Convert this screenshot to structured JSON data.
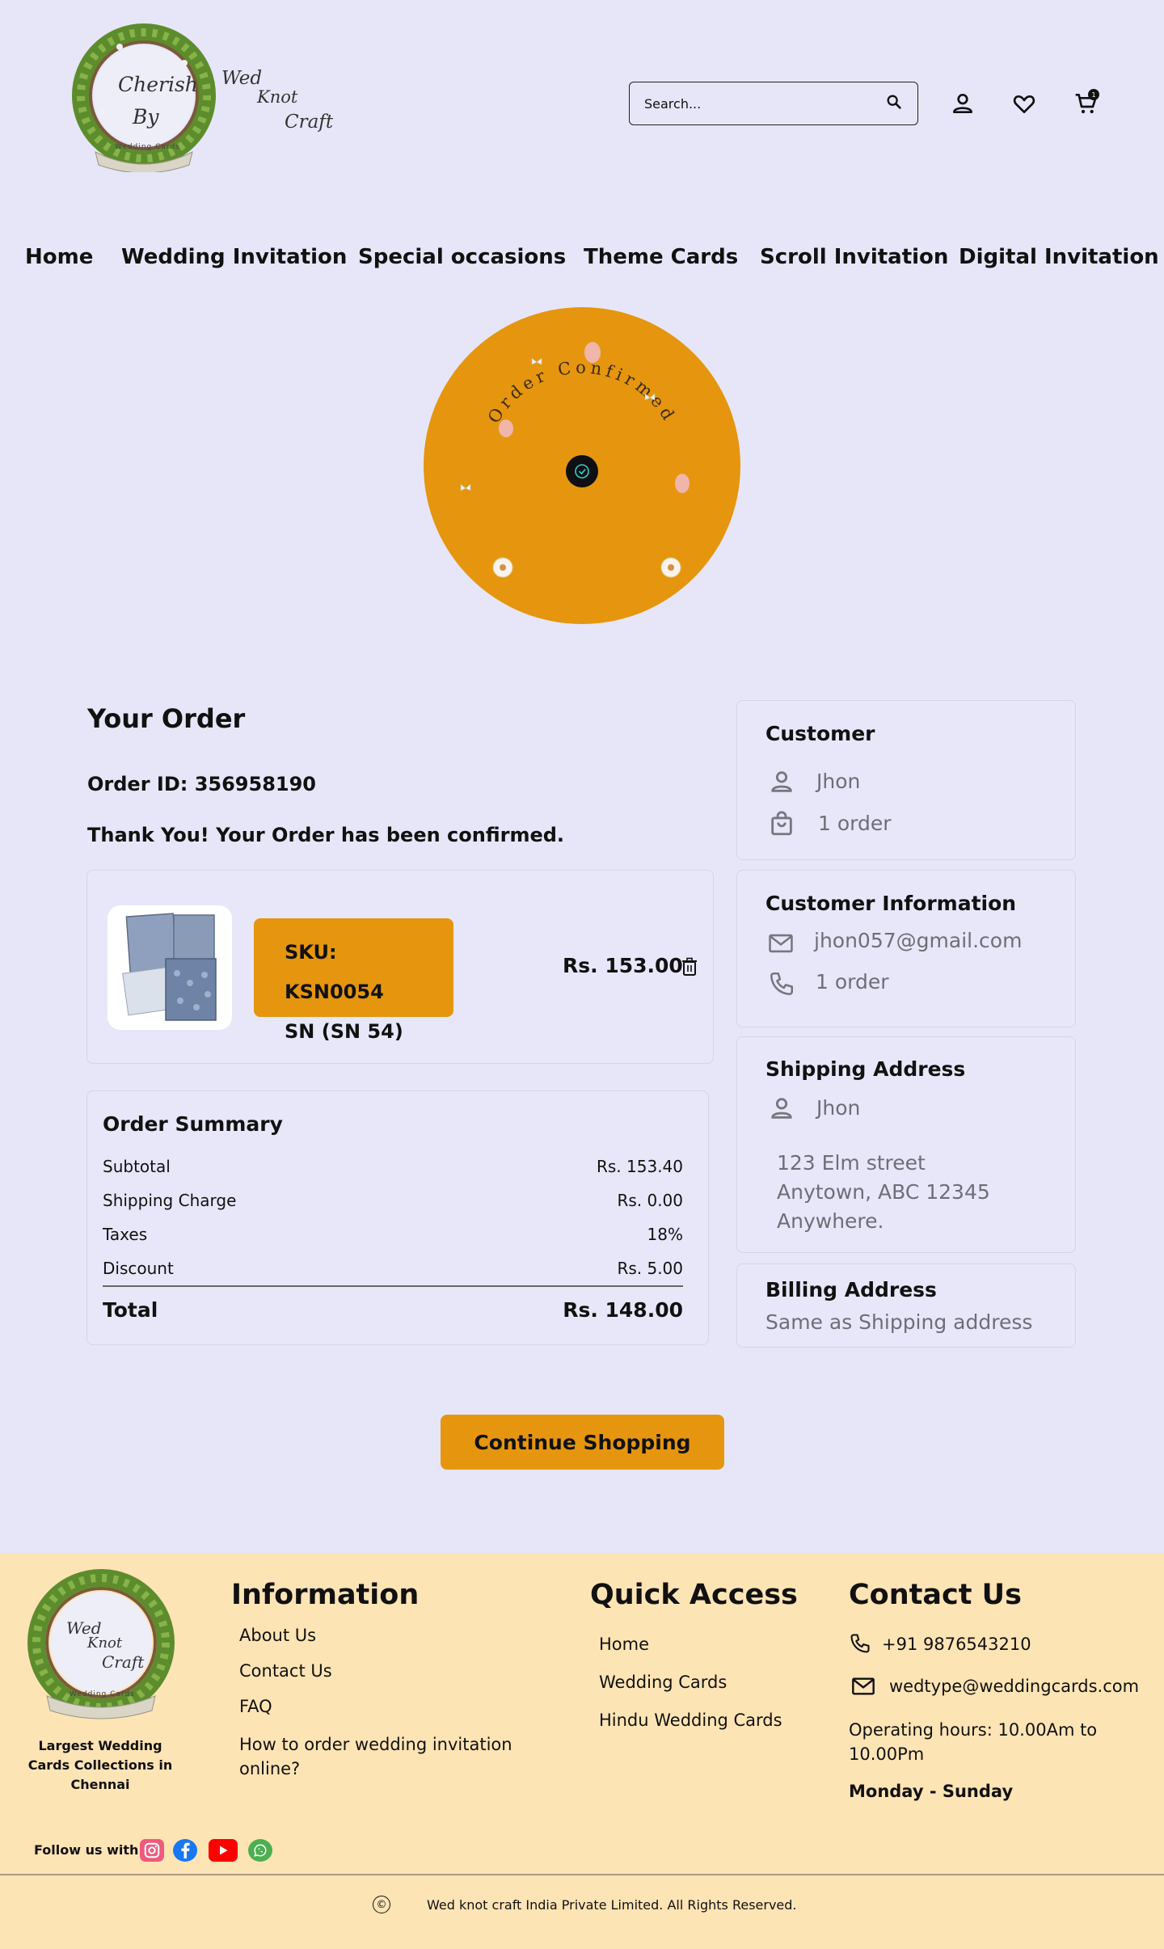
{
  "header": {
    "logo": {
      "line1": "Cherish",
      "line2": "By",
      "line3": "Wed",
      "line4": "Knot",
      "line5": "Craft",
      "ribbon": "Wedding Cards"
    },
    "search_placeholder": "Search...",
    "cart_count": "1"
  },
  "nav": {
    "items": [
      "Home",
      "Wedding Invitation",
      "Special occasions",
      "Theme Cards",
      "Scroll Invitation",
      "Digital Invitation"
    ]
  },
  "hero": {
    "text": "Order Confirmed"
  },
  "order": {
    "heading": "Your Order",
    "order_id": "Order ID: 356958190",
    "message": "Thank You!  Your Order has been confirmed.",
    "item": {
      "sku": "SKU: KSN0054",
      "name": "SN (SN 54)",
      "price": "Rs. 153.00"
    },
    "summary": {
      "title": "Order Summary",
      "rows": [
        {
          "label": "Subtotal",
          "value": "Rs. 153.40"
        },
        {
          "label": "Shipping Charge",
          "value": "Rs. 0.00"
        },
        {
          "label": "Taxes",
          "value": "18%"
        },
        {
          "label": "Discount",
          "value": "Rs. 5.00"
        }
      ],
      "total_label": "Total",
      "total_value": "Rs. 148.00"
    }
  },
  "customer": {
    "title": "Customer",
    "name": "Jhon",
    "orders": "1 order"
  },
  "customer_info": {
    "title": "Customer Information",
    "email": "jhon057@gmail.com",
    "phone": "1 order"
  },
  "shipping": {
    "title": "Shipping Address",
    "name": "Jhon",
    "line1": "123 Elm street",
    "line2": "Anytown, ABC 12345",
    "line3": "Anywhere."
  },
  "billing": {
    "title": "Billing Address",
    "text": "Same as Shipping address"
  },
  "continue_label": "Continue Shopping",
  "footer": {
    "logo": {
      "line1": "Wed",
      "line2": "Knot",
      "line3": "Craft",
      "ribbon": "Wedding Cards"
    },
    "tagline_1": "Largest Wedding",
    "tagline_2": "Cards Collections in",
    "tagline_3": "Chennai",
    "information": {
      "heading": "Information",
      "links": [
        "About Us",
        "Contact Us",
        "FAQ",
        "How to order wedding invitation",
        "online?"
      ]
    },
    "quick_access": {
      "heading": "Quick Access",
      "links": [
        "Home",
        "Wedding Cards",
        "Hindu Wedding Cards"
      ]
    },
    "contact": {
      "heading": "Contact Us",
      "phone": "+91 9876543210",
      "email": "wedtype@weddingcards.com",
      "hours_1": "Operating hours: 10.00Am to",
      "hours_2": "10.00Pm",
      "days": "Monday  - Sunday"
    },
    "follow_label": "Follow us with",
    "copyright_symbol": "©",
    "copyright": "Wed knot craft India Private Limited. All Rights Reserved."
  },
  "colors": {
    "page_bg": "#e7e6f8",
    "accent": "#e5960e",
    "footer_bg": "#fde4b5",
    "muted_text": "#6e6e78"
  }
}
